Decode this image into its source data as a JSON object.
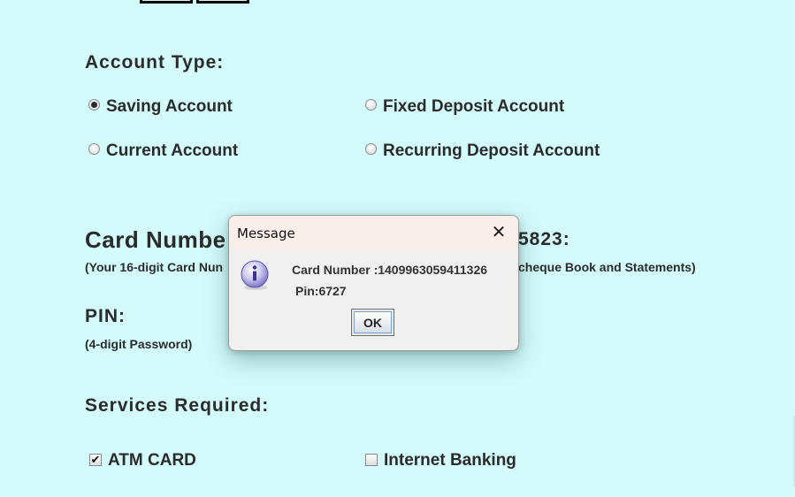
{
  "account_type": {
    "title": "Account Type:",
    "options": [
      {
        "label": "Saving Account",
        "checked": true
      },
      {
        "label": "Fixed Deposit Account",
        "checked": false
      },
      {
        "label": "Current Account",
        "checked": false
      },
      {
        "label": "Recurring Deposit Account",
        "checked": false
      }
    ]
  },
  "card_number": {
    "title": "Card Numbe",
    "note": "(Your 16-digit Card Nun"
  },
  "hidden_right": {
    "number": "5823:",
    "note": "cheque Book and Statements)"
  },
  "pin": {
    "title": "PIN:",
    "note": "(4-digit Password)"
  },
  "services": {
    "title": "Services Required:",
    "options": [
      {
        "label": "ATM CARD",
        "checked": true
      },
      {
        "label": "Internet Banking",
        "checked": false
      }
    ]
  },
  "dialog": {
    "title": "Message",
    "close_glyph": "✕",
    "icon": "info-icon",
    "line1": "Card Number :1409963059411326",
    "line2": "Pin:6727",
    "ok_label": "OK"
  },
  "colors": {
    "background": "#d4fbfb",
    "dialog_titlebar": "#f9eeea",
    "dialog_body": "#f0f0f0"
  }
}
